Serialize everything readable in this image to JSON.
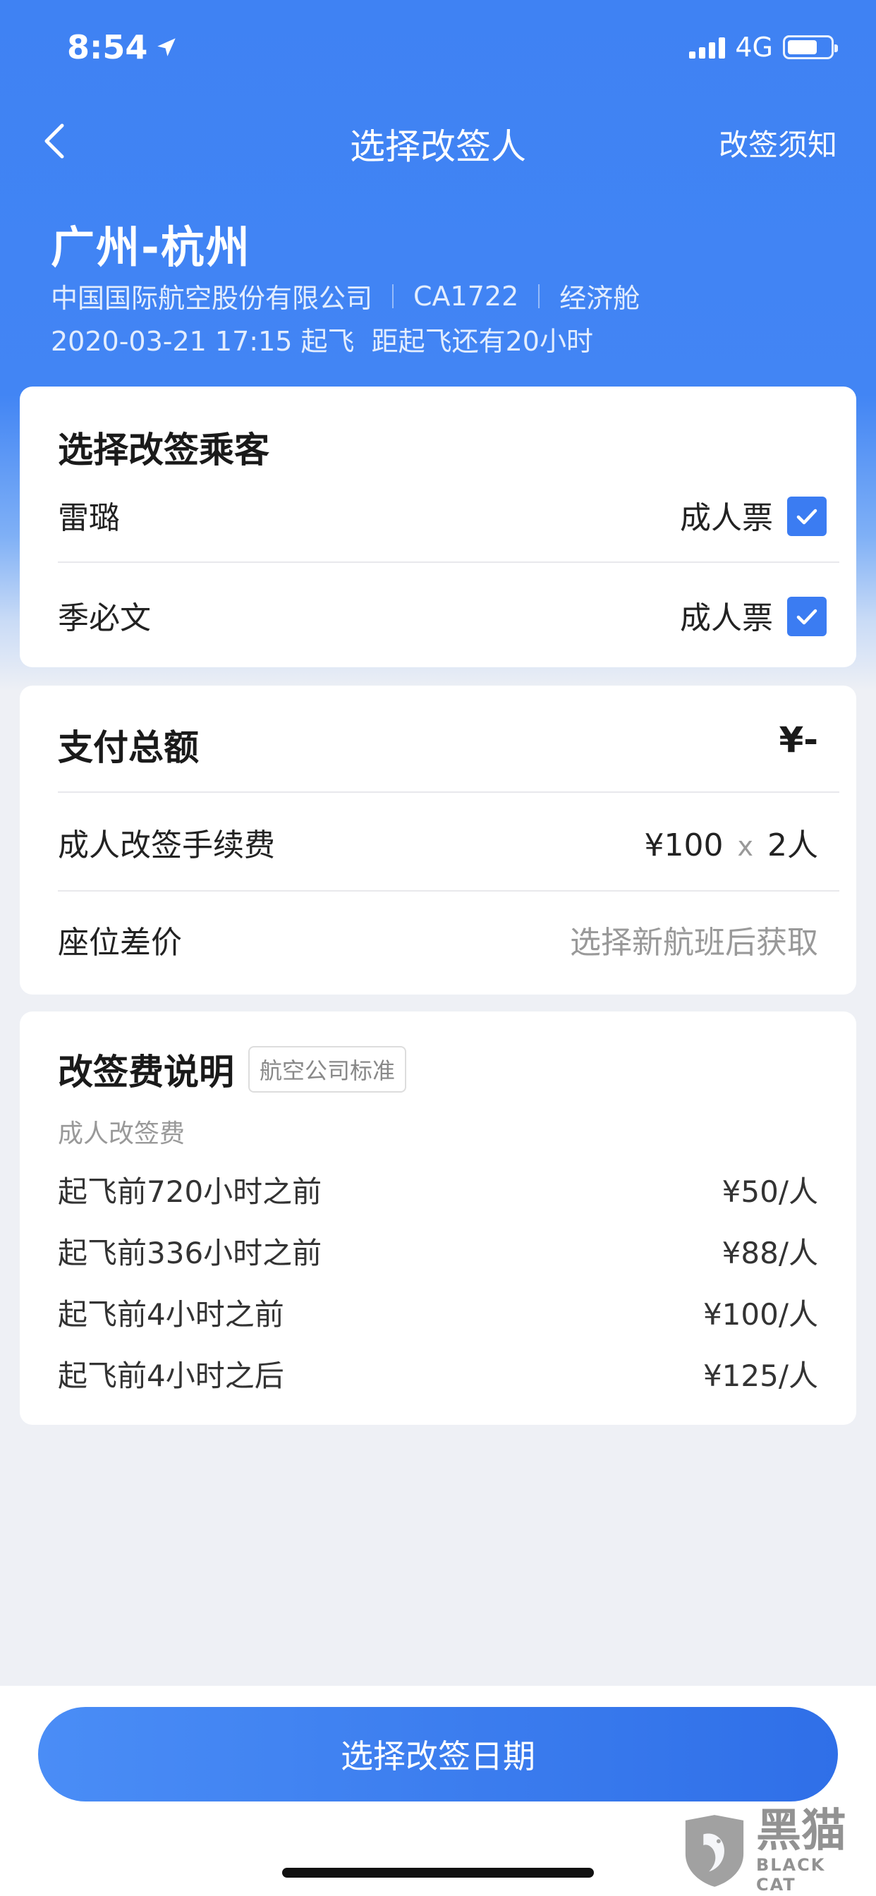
{
  "status_bar": {
    "time": "8:54",
    "network": "4G"
  },
  "nav": {
    "title": "选择改签人",
    "right_link": "改签须知"
  },
  "flight": {
    "route": "广州-杭州",
    "airline": "中国国际航空股份有限公司",
    "flight_no": "CA1722",
    "cabin": "经济舱",
    "departure": "2020-03-21 17:15 起飞",
    "countdown": "距起飞还有20小时"
  },
  "passengers": {
    "title": "选择改签乘客",
    "items": [
      {
        "name": "雷璐",
        "type": "成人票",
        "checked": true
      },
      {
        "name": "季必文",
        "type": "成人票",
        "checked": true
      }
    ]
  },
  "payment": {
    "title": "支付总额",
    "total": "¥-",
    "fee_label": "成人改签手续费",
    "fee_amount": "¥100",
    "fee_times": "x",
    "fee_count": "2人",
    "seat_label": "座位差价",
    "seat_value": "选择新航班后获取"
  },
  "rules": {
    "title": "改签费说明",
    "tag": "航空公司标准",
    "subtitle": "成人改签费",
    "items": [
      {
        "condition": "起飞前720小时之前",
        "price": "¥50/人"
      },
      {
        "condition": "起飞前336小时之前",
        "price": "¥88/人"
      },
      {
        "condition": "起飞前4小时之前",
        "price": "¥100/人"
      },
      {
        "condition": "起飞前4小时之后",
        "price": "¥125/人"
      }
    ]
  },
  "action": {
    "primary_label": "选择改签日期"
  },
  "watermark": {
    "cn": "黑猫",
    "en": "BLACK CAT"
  },
  "colors": {
    "primary": "#4285f4",
    "checkbox": "#3b7cf2",
    "background": "#eef0f5"
  }
}
